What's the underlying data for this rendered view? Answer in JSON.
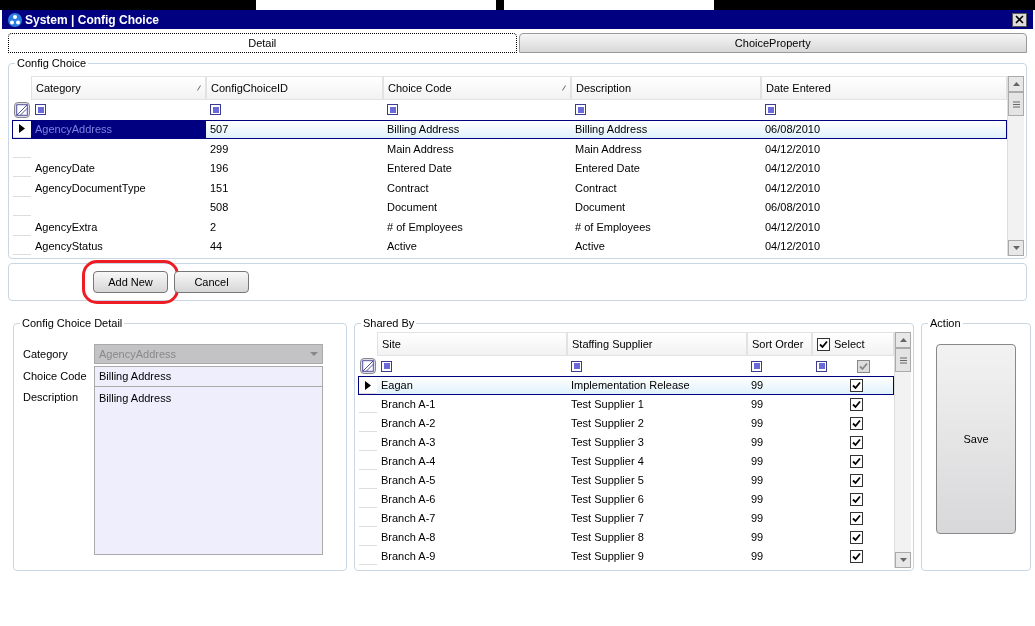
{
  "window": {
    "title": "System | Config Choice"
  },
  "tabs": [
    {
      "label": "Detail",
      "selected": true
    },
    {
      "label": "ChoiceProperty",
      "selected": false
    }
  ],
  "config_choice": {
    "title": "Config Choice",
    "columns": [
      {
        "label": "Category",
        "sorted": true
      },
      {
        "label": "ConfigChoiceID",
        "sorted": false
      },
      {
        "label": "Choice Code",
        "sorted": true
      },
      {
        "label": "Description",
        "sorted": false
      },
      {
        "label": "Date Entered",
        "sorted": false
      }
    ],
    "rows": [
      {
        "cells": [
          "AgencyAddress",
          "507",
          "Billing Address",
          "Billing Address",
          "06/08/2010"
        ],
        "selected": true
      },
      {
        "cells": [
          "",
          "299",
          "Main Address",
          "Main Address",
          "04/12/2010"
        ],
        "selected": false
      },
      {
        "cells": [
          "AgencyDate",
          "196",
          "Entered Date",
          "Entered Date",
          "04/12/2010"
        ],
        "selected": false
      },
      {
        "cells": [
          "AgencyDocumentType",
          "151",
          "Contract",
          "Contract",
          "04/12/2010"
        ],
        "selected": false
      },
      {
        "cells": [
          "",
          "508",
          "Document",
          "Document",
          "06/08/2010"
        ],
        "selected": false
      },
      {
        "cells": [
          "AgencyExtra",
          "2",
          "# of Employees",
          "# of Employees",
          "04/12/2010"
        ],
        "selected": false
      },
      {
        "cells": [
          "AgencyStatus",
          "44",
          "Active",
          "Active",
          "04/12/2010"
        ],
        "selected": false
      }
    ]
  },
  "buttons": [
    {
      "label": "Add New",
      "highlighted": true
    },
    {
      "label": "Cancel",
      "highlighted": false
    }
  ],
  "detail": {
    "title": "Config Choice  Detail",
    "fields": [
      {
        "label": "Category",
        "kind": "dropdown",
        "value": "AgencyAddress",
        "disabled": true
      },
      {
        "label": "Choice Code",
        "kind": "text",
        "value": "Billing Address",
        "disabled": false
      },
      {
        "label": "Description",
        "kind": "textarea",
        "value": "Billing Address",
        "disabled": false
      }
    ]
  },
  "shared_by": {
    "title": "Shared By",
    "columns": [
      {
        "label": "Site"
      },
      {
        "label": "Staffing Supplier"
      },
      {
        "label": "Sort Order"
      },
      {
        "label": "Select",
        "checked": true,
        "filter_checked": true
      }
    ],
    "rows": [
      {
        "site": "Eagan",
        "supplier": "Implementation Release",
        "sort_order": "99",
        "checked": true,
        "selected": true
      },
      {
        "site": "Branch A-1",
        "supplier": "Test Supplier 1",
        "sort_order": "99",
        "checked": true,
        "selected": false
      },
      {
        "site": "Branch A-2",
        "supplier": "Test Supplier 2",
        "sort_order": "99",
        "checked": true,
        "selected": false
      },
      {
        "site": "Branch A-3",
        "supplier": "Test Supplier 3",
        "sort_order": "99",
        "checked": true,
        "selected": false
      },
      {
        "site": "Branch A-4",
        "supplier": "Test Supplier 4",
        "sort_order": "99",
        "checked": true,
        "selected": false
      },
      {
        "site": "Branch A-5",
        "supplier": "Test Supplier 5",
        "sort_order": "99",
        "checked": true,
        "selected": false
      },
      {
        "site": "Branch A-6",
        "supplier": "Test Supplier 6",
        "sort_order": "99",
        "checked": true,
        "selected": false
      },
      {
        "site": "Branch A-7",
        "supplier": "Test Supplier 7",
        "sort_order": "99",
        "checked": true,
        "selected": false
      },
      {
        "site": "Branch A-8",
        "supplier": "Test Supplier 8",
        "sort_order": "99",
        "checked": true,
        "selected": false
      },
      {
        "site": "Branch A-9",
        "supplier": "Test Supplier 9",
        "sort_order": "99",
        "checked": true,
        "selected": false
      }
    ]
  },
  "action": {
    "title": "Action",
    "button": "Save"
  }
}
